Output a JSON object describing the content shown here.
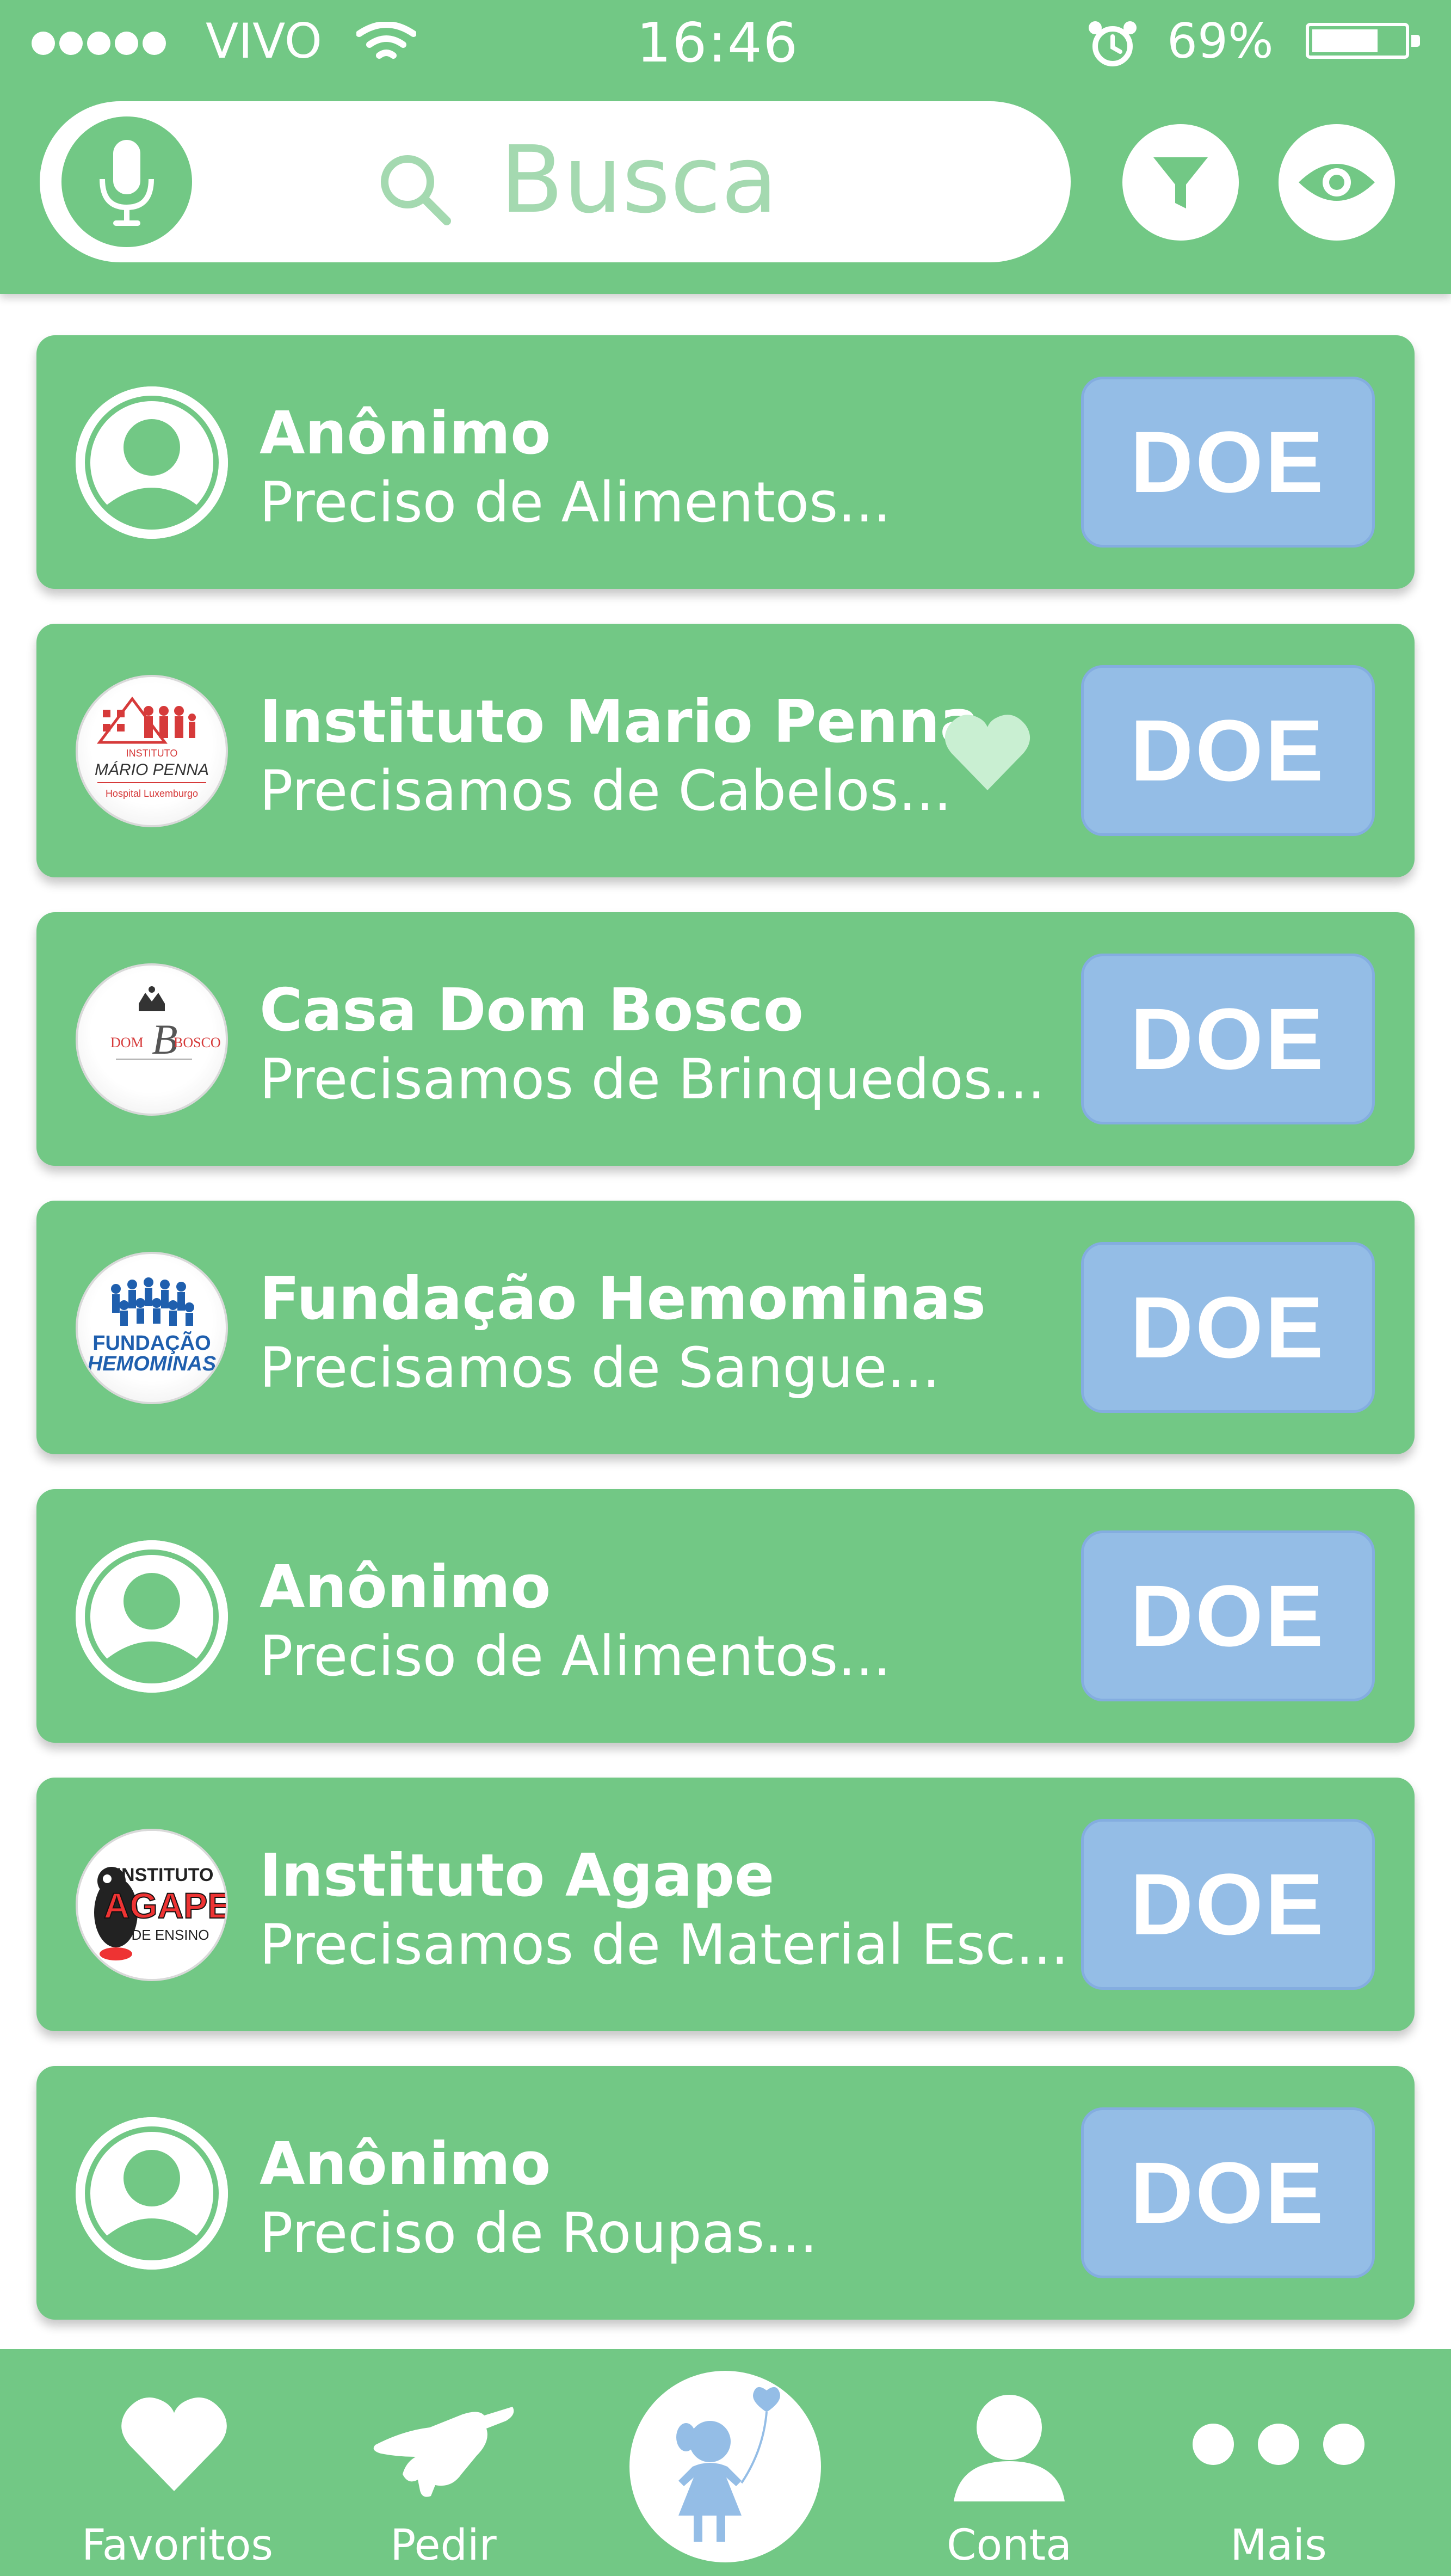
{
  "status_bar": {
    "carrier": "VIVO",
    "time": "16:46",
    "battery": "69%"
  },
  "search": {
    "placeholder": "Busca"
  },
  "items": [
    {
      "name": "Anônimo",
      "description": "Preciso de Alimentos...",
      "avatar": "user-icon",
      "favorite": false,
      "button": "DOE"
    },
    {
      "name": "Instituto Mario Penna",
      "description": "Precisamos de Cabelos...",
      "avatar": "logo",
      "logo_text": [
        "INSTITUTO",
        "MÁRIO PENNA",
        "Hospital Luxemburgo"
      ],
      "favorite": true,
      "button": "DOE"
    },
    {
      "name": "Casa Dom Bosco",
      "description": "Precisamos de Brinquedos...",
      "avatar": "logo",
      "logo_text": [
        "DOM",
        "BOSCO"
      ],
      "favorite": false,
      "button": "DOE"
    },
    {
      "name": "Fundação Hemominas",
      "description": "Precisamos de Sangue...",
      "avatar": "logo",
      "logo_text": [
        "FUNDAÇÃO",
        "HEMOMINAS"
      ],
      "favorite": false,
      "button": "DOE"
    },
    {
      "name": "Anônimo",
      "description": "Preciso de Alimentos...",
      "avatar": "user-icon",
      "favorite": false,
      "button": "DOE"
    },
    {
      "name": "Instituto Agape",
      "description": "Precisamos de Material Esc...",
      "avatar": "logo",
      "logo_text": [
        "INSTITUTO",
        "AGAPE",
        "DE ENSINO"
      ],
      "favorite": false,
      "button": "DOE"
    },
    {
      "name": "Anônimo",
      "description": "Preciso de Roupas...",
      "avatar": "user-icon",
      "favorite": false,
      "button": "DOE"
    }
  ],
  "tabbar": {
    "favoritos": "Favoritos",
    "pedir": "Pedir",
    "conta": "Conta",
    "mais": "Mais"
  },
  "colors": {
    "primary_green": "#72c885",
    "donate_blue": "#94bde6",
    "heart_light": "#c9efd2",
    "figure_blue": "#94bde6"
  }
}
